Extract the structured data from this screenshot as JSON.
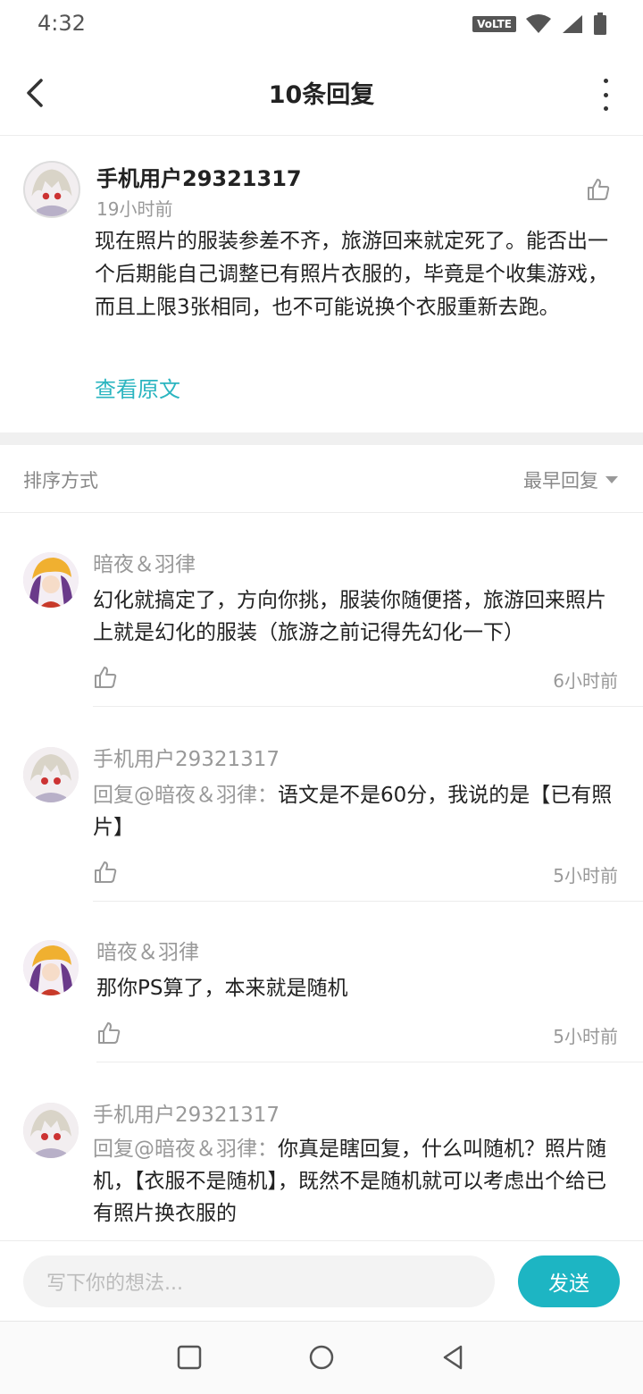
{
  "status_bar": {
    "time": "4:32",
    "volte": "VoLTE"
  },
  "header": {
    "title": "10条回复"
  },
  "main_comment": {
    "username": "手机用户29321317",
    "time": "19小时前",
    "text": "现在照片的服装参差不齐，旅游回来就定死了。能否出一个后期能自己调整已有照片衣服的，毕竟是个收集游戏，而且上限3张相同，也不可能说换个衣服重新去跑。",
    "view_original": "查看原文"
  },
  "sort_bar": {
    "label": "排序方式",
    "selected": "最早回复"
  },
  "replies": [
    {
      "username": "暗夜＆羽律",
      "mention": "",
      "text": "幻化就搞定了，方向你挑，服装你随便搭，旅游回来照片上就是幻化的服装（旅游之前记得先幻化一下）",
      "time": "6小时前"
    },
    {
      "username": "手机用户29321317",
      "mention": "回复@暗夜＆羽律：",
      "text": "语文是不是60分，我说的是【已有照片】",
      "time": "5小时前"
    },
    {
      "username": "暗夜＆羽律",
      "mention": "",
      "text": "那你PS算了，本来就是随机",
      "time": "5小时前"
    },
    {
      "username": "手机用户29321317",
      "mention": "回复@暗夜＆羽律：",
      "text": "你真是瞎回复，什么叫随机？照片随机，【衣服不是随机】，既然不是随机就可以考虑出个给已有照片换衣服的",
      "time": ""
    }
  ],
  "input_bar": {
    "placeholder": "写下你的想法...",
    "send_label": "发送"
  },
  "colors": {
    "accent": "#1db5c3",
    "link": "#2bb5c0",
    "muted": "#999999"
  }
}
